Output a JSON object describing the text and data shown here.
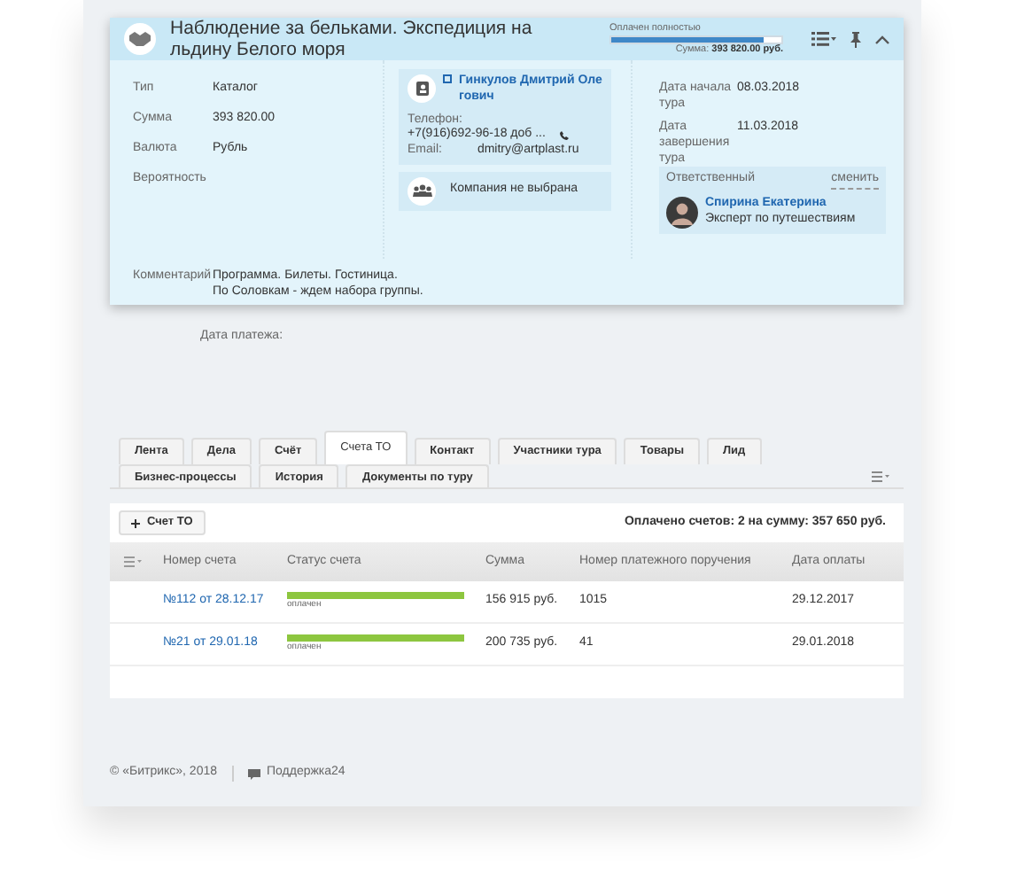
{
  "header": {
    "title": "Наблюдение за бельками. Экспедиция на льдину Белого моря",
    "payment": {
      "label": "Оплачен полностью",
      "level": 0.9,
      "sum_label": "Сумма:",
      "sum": "393 820.00 руб."
    }
  },
  "fields": [
    {
      "label": "Тип",
      "value": "Каталог"
    },
    {
      "label": "Сумма",
      "value": "393 820.00"
    },
    {
      "label": "Валюта",
      "value": "Рубль"
    },
    {
      "label": "Вероятность"
    }
  ],
  "contact": {
    "name": "Гинкулов Дмитрий Олегович",
    "phone_label": "Телефон:",
    "phone": "+7(916)692-96-18 доб ...",
    "email_label": "Email:",
    "email": "dmitry@artplast.ru",
    "company": "Компания не выбрана"
  },
  "dates": [
    {
      "label": "Дата начала тура",
      "value": "08.03.2018"
    },
    {
      "label": "Дата завершения тура",
      "value": "11.03.2018"
    }
  ],
  "responsible": {
    "label": "Ответственный",
    "change": "сменить",
    "name": "Спирина Екатерина",
    "role": "Эксперт по путешествиям"
  },
  "comment": {
    "label": "Комментарий",
    "lines": [
      "Программа. Билеты. Гостиница.",
      "По Соловкам - ждем набора группы."
    ]
  },
  "payment_date_label": "Дата платежа:",
  "tabs": [
    [
      {
        "label": "Лента",
        "selected": false
      },
      {
        "label": "Дела",
        "selected": false
      },
      {
        "label": "Счёт",
        "selected": false
      },
      {
        "label": "Счета ТО",
        "selected": true
      },
      {
        "label": "Контакт",
        "selected": false
      },
      {
        "label": "Участники тура",
        "selected": false
      },
      {
        "label": "Товары",
        "selected": false
      },
      {
        "label": "Лид",
        "selected": false
      }
    ],
    [
      {
        "label": "Бизнес-процессы",
        "selected": false
      },
      {
        "label": "История",
        "selected": false
      },
      {
        "label": "Документы по туру",
        "selected": false
      }
    ]
  ],
  "toolbar": {
    "add_button": "Счет ТО",
    "summary": "Оплачено счетов: 2 на сумму: 357 650 руб."
  },
  "table": {
    "columns": [
      "Номер счета",
      "Статус счета",
      "Сумма",
      "Номер платежного поручения",
      "Дата оплаты"
    ],
    "rows": [
      {
        "number": "№112 от 28.12.17",
        "status": {
          "level": 1,
          "label": "оплачен"
        },
        "sum": "156 915 руб.",
        "order": "1015",
        "date": "29.12.2017"
      },
      {
        "number": "№21 от 29.01.18",
        "status": {
          "level": 1,
          "label": "оплачен"
        },
        "sum": "200 735 руб.",
        "order": "41",
        "date": "29.01.2018"
      }
    ]
  },
  "footer": {
    "copyright": "© «Битрикс», 2018",
    "support": "Поддержка24"
  }
}
